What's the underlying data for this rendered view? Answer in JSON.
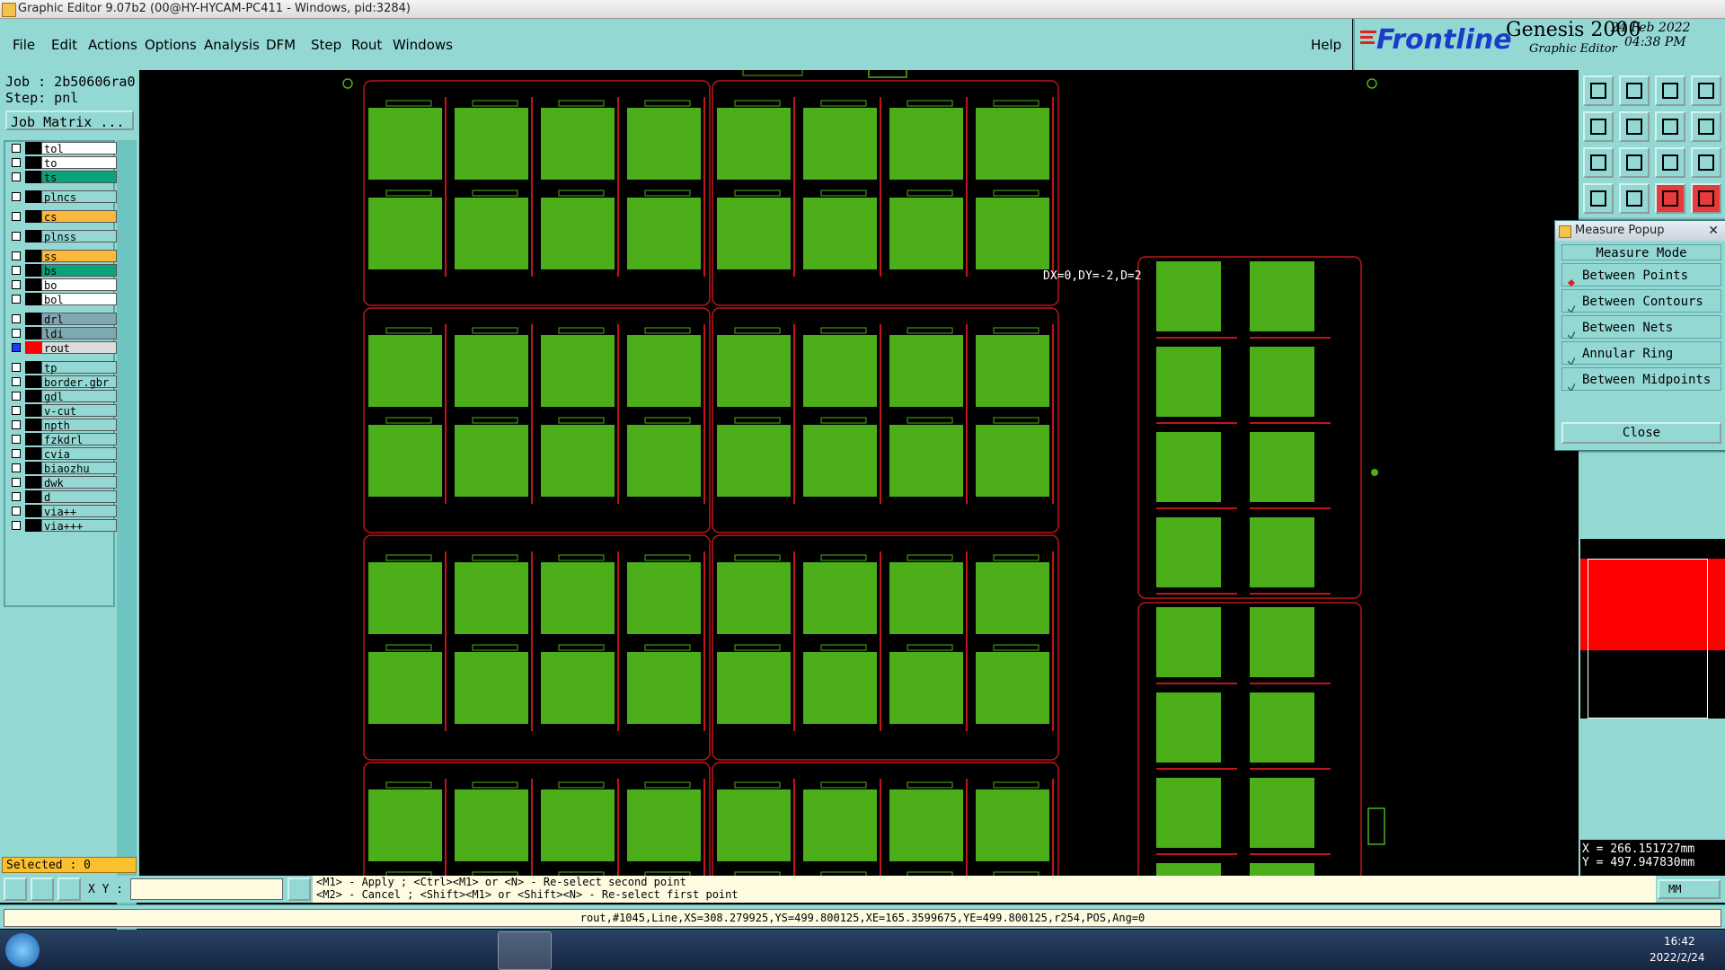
{
  "window": {
    "title": "Graphic Editor 9.07b2 (00@HY-HYCAM-PC411 - Windows, pid:3284)"
  },
  "menu": {
    "items": [
      "File",
      "Edit",
      "Actions",
      "Options",
      "Analysis",
      "DFM",
      "Step",
      "Rout",
      "Windows"
    ],
    "help": "Help"
  },
  "brand": {
    "logo": "Frontline",
    "product": "Genesis 2000",
    "subtitle": "Graphic Editor",
    "date": "24 Feb 2022",
    "time": "04:38 PM"
  },
  "job": {
    "job_line": "Job : 2b50606ra0",
    "step_line": "Step: pnl",
    "matrix_button": "Job Matrix ..."
  },
  "layers": [
    {
      "name": "tol",
      "color": "#ffffff",
      "checked": false
    },
    {
      "name": "to",
      "color": "#ffffff",
      "checked": false
    },
    {
      "name": "ts",
      "color": "#0aa37a",
      "checked": false
    },
    {
      "name": "plncs",
      "color": "#94d8d4",
      "checked": false
    },
    {
      "name": "cs",
      "color": "#fbb83a",
      "checked": false
    },
    {
      "name": "plnss",
      "color": "#94d8d4",
      "checked": false
    },
    {
      "name": "ss",
      "color": "#fbb83a",
      "checked": false
    },
    {
      "name": "bs",
      "color": "#0aa37a",
      "checked": false
    },
    {
      "name": "bo",
      "color": "#ffffff",
      "checked": false
    },
    {
      "name": "bol",
      "color": "#ffffff",
      "checked": false
    },
    {
      "name": "drl",
      "color": "#7fa8b0",
      "checked": false
    },
    {
      "name": "ldi",
      "color": "#7fa8b0",
      "checked": false
    },
    {
      "name": "rout",
      "color": "#dcdcdc",
      "checked": true,
      "active": true
    },
    {
      "name": "tp",
      "color": "#94d8d4",
      "checked": false
    },
    {
      "name": "border.gbr",
      "color": "#94d8d4",
      "checked": false
    },
    {
      "name": "gdl",
      "color": "#94d8d4",
      "checked": false
    },
    {
      "name": "v-cut",
      "color": "#94d8d4",
      "checked": false
    },
    {
      "name": "npth",
      "color": "#94d8d4",
      "checked": false
    },
    {
      "name": "fzkdrl",
      "color": "#94d8d4",
      "checked": false
    },
    {
      "name": "cvia",
      "color": "#94d8d4",
      "checked": false
    },
    {
      "name": "biaozhu",
      "color": "#94d8d4",
      "checked": false
    },
    {
      "name": "dwk",
      "color": "#94d8d4",
      "checked": false
    },
    {
      "name": "d",
      "color": "#94d8d4",
      "checked": false
    },
    {
      "name": "via++",
      "color": "#94d8d4",
      "checked": false
    },
    {
      "name": "via+++",
      "color": "#94d8d4",
      "checked": false
    }
  ],
  "selected": "Selected : 0",
  "canvas": {
    "measure_label": "DX=0,DY=-2,D=2"
  },
  "measure_popup": {
    "title": "Measure Popup",
    "header": "Measure Mode",
    "options": [
      {
        "label": "Between Points",
        "selected": true
      },
      {
        "label": "Between Contours",
        "selected": false
      },
      {
        "label": "Between Nets",
        "selected": false
      },
      {
        "label": "Annular Ring",
        "selected": false
      },
      {
        "label": "Between Midpoints",
        "selected": false
      }
    ],
    "close": "Close"
  },
  "coords": {
    "x": "X = 266.151727mm",
    "y": "Y = 497.947830mm"
  },
  "bottom": {
    "xy_label": "X Y :",
    "xy_value": "",
    "hint1": "<M1> - Apply  ; <Ctrl><M1> or <N> - Re-select second point",
    "hint2": "<M2> - Cancel ; <Shift><M1> or <Shift><N> - Re-select first point",
    "units": "MM"
  },
  "status": "rout,#1045,Line,XS=308.279925,YS=499.800125,XE=165.3599675,YE=499.800125,r254,POS,Ang=0",
  "taskbar": {
    "time": "16:42",
    "date": "2022/2/24"
  },
  "colors": {
    "panel": "#94d8d4",
    "board": "#4caf1a",
    "rout": "#c0151a",
    "accent_red": "#e83a3a"
  }
}
